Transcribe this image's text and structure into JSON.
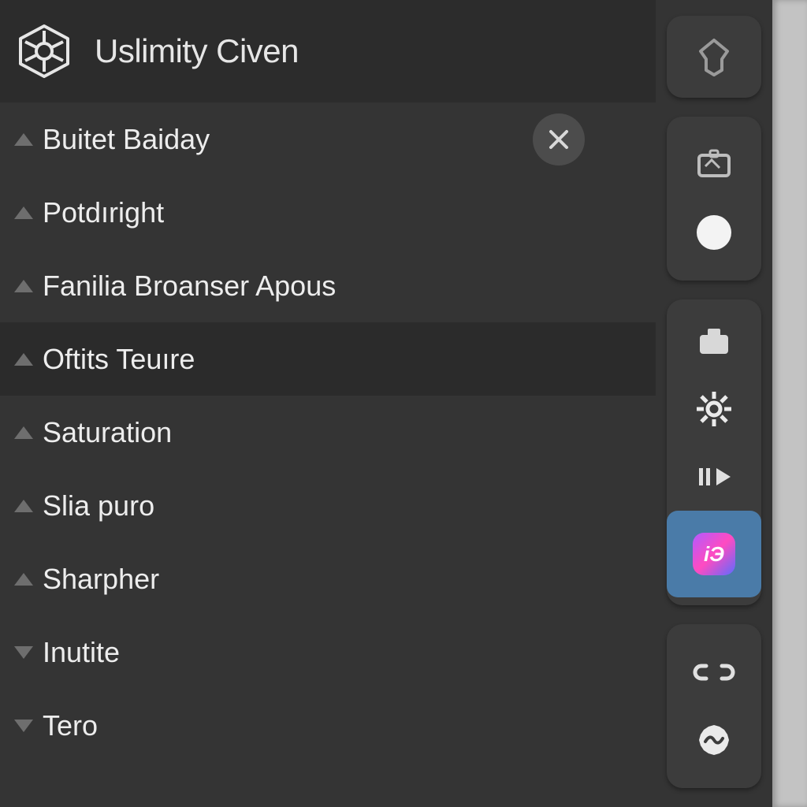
{
  "header": {
    "title": "Uslimity Civen"
  },
  "list": {
    "items": [
      {
        "label": "Buitet Baiday",
        "dir": "up",
        "close": true,
        "selected": false
      },
      {
        "label": "Potdıright",
        "dir": "up",
        "close": false,
        "selected": false
      },
      {
        "label": "Fanilia Broanser Apous",
        "dir": "up",
        "close": false,
        "selected": false
      },
      {
        "label": "Oftits Teuıre",
        "dir": "up",
        "close": false,
        "selected": true
      },
      {
        "label": "Saturation",
        "dir": "up",
        "close": false,
        "selected": false
      },
      {
        "label": "Slia puro",
        "dir": "up",
        "close": false,
        "selected": false
      },
      {
        "label": "Sharpher",
        "dir": "up",
        "close": false,
        "selected": false
      },
      {
        "label": "Inutite",
        "dir": "down",
        "close": false,
        "selected": false
      },
      {
        "label": "Tero",
        "dir": "down",
        "close": false,
        "selected": false
      }
    ]
  },
  "sidebar": {
    "groups": [
      {
        "tools": [
          {
            "name": "pin-icon"
          }
        ]
      },
      {
        "tools": [
          {
            "name": "card-icon"
          },
          {
            "name": "circle-icon"
          }
        ]
      },
      {
        "tools": [
          {
            "name": "camera-icon"
          },
          {
            "name": "gear-icon"
          },
          {
            "name": "play-icon"
          },
          {
            "name": "app-badge-icon",
            "active": true
          }
        ]
      },
      {
        "tools": [
          {
            "name": "link-icon"
          },
          {
            "name": "wave-icon"
          }
        ]
      }
    ],
    "badge_label": "iЭ"
  }
}
